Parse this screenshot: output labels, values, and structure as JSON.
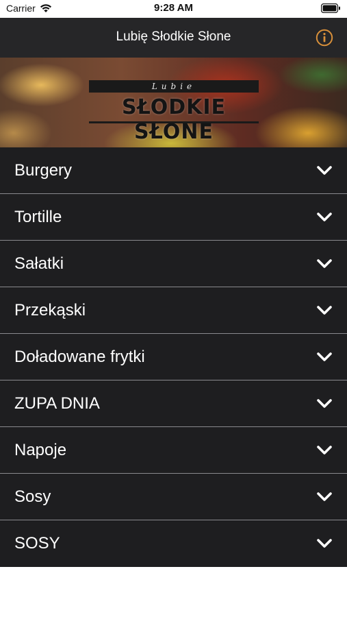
{
  "status_bar": {
    "carrier": "Carrier",
    "time": "9:28 AM"
  },
  "nav": {
    "title": "Lubię Słodkie Słone",
    "info_icon": "info-icon",
    "accent_color": "#d9903a"
  },
  "banner": {
    "logo_small": "Lubie",
    "logo_big": "SŁODKIE SŁONE"
  },
  "menu": {
    "items": [
      {
        "label": "Burgery"
      },
      {
        "label": "Tortille"
      },
      {
        "label": "Sałatki"
      },
      {
        "label": "Przekąski"
      },
      {
        "label": "Doładowane frytki"
      },
      {
        "label": "ZUPA DNIA"
      },
      {
        "label": "Napoje"
      },
      {
        "label": "Sosy"
      },
      {
        "label": "SOSY"
      }
    ],
    "chevron_icon": "chevron-down-icon"
  }
}
